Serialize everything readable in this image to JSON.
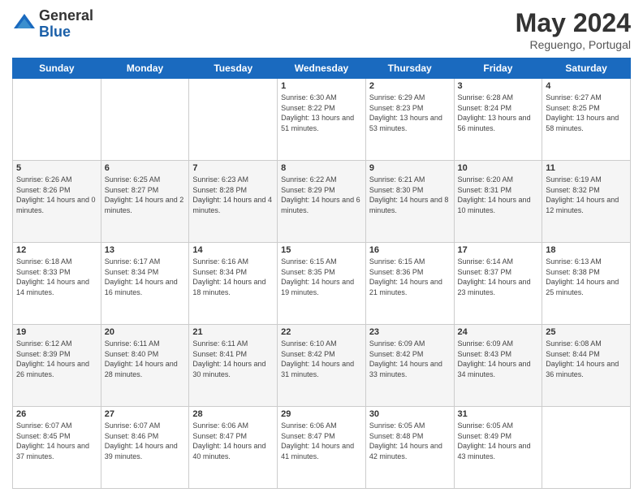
{
  "header": {
    "logo_general": "General",
    "logo_blue": "Blue",
    "month_year": "May 2024",
    "location": "Reguengo, Portugal"
  },
  "days_of_week": [
    "Sunday",
    "Monday",
    "Tuesday",
    "Wednesday",
    "Thursday",
    "Friday",
    "Saturday"
  ],
  "weeks": [
    [
      {
        "day": "",
        "sunrise": "",
        "sunset": "",
        "daylight": ""
      },
      {
        "day": "",
        "sunrise": "",
        "sunset": "",
        "daylight": ""
      },
      {
        "day": "",
        "sunrise": "",
        "sunset": "",
        "daylight": ""
      },
      {
        "day": "1",
        "sunrise": "Sunrise: 6:30 AM",
        "sunset": "Sunset: 8:22 PM",
        "daylight": "Daylight: 13 hours and 51 minutes."
      },
      {
        "day": "2",
        "sunrise": "Sunrise: 6:29 AM",
        "sunset": "Sunset: 8:23 PM",
        "daylight": "Daylight: 13 hours and 53 minutes."
      },
      {
        "day": "3",
        "sunrise": "Sunrise: 6:28 AM",
        "sunset": "Sunset: 8:24 PM",
        "daylight": "Daylight: 13 hours and 56 minutes."
      },
      {
        "day": "4",
        "sunrise": "Sunrise: 6:27 AM",
        "sunset": "Sunset: 8:25 PM",
        "daylight": "Daylight: 13 hours and 58 minutes."
      }
    ],
    [
      {
        "day": "5",
        "sunrise": "Sunrise: 6:26 AM",
        "sunset": "Sunset: 8:26 PM",
        "daylight": "Daylight: 14 hours and 0 minutes."
      },
      {
        "day": "6",
        "sunrise": "Sunrise: 6:25 AM",
        "sunset": "Sunset: 8:27 PM",
        "daylight": "Daylight: 14 hours and 2 minutes."
      },
      {
        "day": "7",
        "sunrise": "Sunrise: 6:23 AM",
        "sunset": "Sunset: 8:28 PM",
        "daylight": "Daylight: 14 hours and 4 minutes."
      },
      {
        "day": "8",
        "sunrise": "Sunrise: 6:22 AM",
        "sunset": "Sunset: 8:29 PM",
        "daylight": "Daylight: 14 hours and 6 minutes."
      },
      {
        "day": "9",
        "sunrise": "Sunrise: 6:21 AM",
        "sunset": "Sunset: 8:30 PM",
        "daylight": "Daylight: 14 hours and 8 minutes."
      },
      {
        "day": "10",
        "sunrise": "Sunrise: 6:20 AM",
        "sunset": "Sunset: 8:31 PM",
        "daylight": "Daylight: 14 hours and 10 minutes."
      },
      {
        "day": "11",
        "sunrise": "Sunrise: 6:19 AM",
        "sunset": "Sunset: 8:32 PM",
        "daylight": "Daylight: 14 hours and 12 minutes."
      }
    ],
    [
      {
        "day": "12",
        "sunrise": "Sunrise: 6:18 AM",
        "sunset": "Sunset: 8:33 PM",
        "daylight": "Daylight: 14 hours and 14 minutes."
      },
      {
        "day": "13",
        "sunrise": "Sunrise: 6:17 AM",
        "sunset": "Sunset: 8:34 PM",
        "daylight": "Daylight: 14 hours and 16 minutes."
      },
      {
        "day": "14",
        "sunrise": "Sunrise: 6:16 AM",
        "sunset": "Sunset: 8:34 PM",
        "daylight": "Daylight: 14 hours and 18 minutes."
      },
      {
        "day": "15",
        "sunrise": "Sunrise: 6:15 AM",
        "sunset": "Sunset: 8:35 PM",
        "daylight": "Daylight: 14 hours and 19 minutes."
      },
      {
        "day": "16",
        "sunrise": "Sunrise: 6:15 AM",
        "sunset": "Sunset: 8:36 PM",
        "daylight": "Daylight: 14 hours and 21 minutes."
      },
      {
        "day": "17",
        "sunrise": "Sunrise: 6:14 AM",
        "sunset": "Sunset: 8:37 PM",
        "daylight": "Daylight: 14 hours and 23 minutes."
      },
      {
        "day": "18",
        "sunrise": "Sunrise: 6:13 AM",
        "sunset": "Sunset: 8:38 PM",
        "daylight": "Daylight: 14 hours and 25 minutes."
      }
    ],
    [
      {
        "day": "19",
        "sunrise": "Sunrise: 6:12 AM",
        "sunset": "Sunset: 8:39 PM",
        "daylight": "Daylight: 14 hours and 26 minutes."
      },
      {
        "day": "20",
        "sunrise": "Sunrise: 6:11 AM",
        "sunset": "Sunset: 8:40 PM",
        "daylight": "Daylight: 14 hours and 28 minutes."
      },
      {
        "day": "21",
        "sunrise": "Sunrise: 6:11 AM",
        "sunset": "Sunset: 8:41 PM",
        "daylight": "Daylight: 14 hours and 30 minutes."
      },
      {
        "day": "22",
        "sunrise": "Sunrise: 6:10 AM",
        "sunset": "Sunset: 8:42 PM",
        "daylight": "Daylight: 14 hours and 31 minutes."
      },
      {
        "day": "23",
        "sunrise": "Sunrise: 6:09 AM",
        "sunset": "Sunset: 8:42 PM",
        "daylight": "Daylight: 14 hours and 33 minutes."
      },
      {
        "day": "24",
        "sunrise": "Sunrise: 6:09 AM",
        "sunset": "Sunset: 8:43 PM",
        "daylight": "Daylight: 14 hours and 34 minutes."
      },
      {
        "day": "25",
        "sunrise": "Sunrise: 6:08 AM",
        "sunset": "Sunset: 8:44 PM",
        "daylight": "Daylight: 14 hours and 36 minutes."
      }
    ],
    [
      {
        "day": "26",
        "sunrise": "Sunrise: 6:07 AM",
        "sunset": "Sunset: 8:45 PM",
        "daylight": "Daylight: 14 hours and 37 minutes."
      },
      {
        "day": "27",
        "sunrise": "Sunrise: 6:07 AM",
        "sunset": "Sunset: 8:46 PM",
        "daylight": "Daylight: 14 hours and 39 minutes."
      },
      {
        "day": "28",
        "sunrise": "Sunrise: 6:06 AM",
        "sunset": "Sunset: 8:47 PM",
        "daylight": "Daylight: 14 hours and 40 minutes."
      },
      {
        "day": "29",
        "sunrise": "Sunrise: 6:06 AM",
        "sunset": "Sunset: 8:47 PM",
        "daylight": "Daylight: 14 hours and 41 minutes."
      },
      {
        "day": "30",
        "sunrise": "Sunrise: 6:05 AM",
        "sunset": "Sunset: 8:48 PM",
        "daylight": "Daylight: 14 hours and 42 minutes."
      },
      {
        "day": "31",
        "sunrise": "Sunrise: 6:05 AM",
        "sunset": "Sunset: 8:49 PM",
        "daylight": "Daylight: 14 hours and 43 minutes."
      },
      {
        "day": "",
        "sunrise": "",
        "sunset": "",
        "daylight": ""
      }
    ]
  ]
}
